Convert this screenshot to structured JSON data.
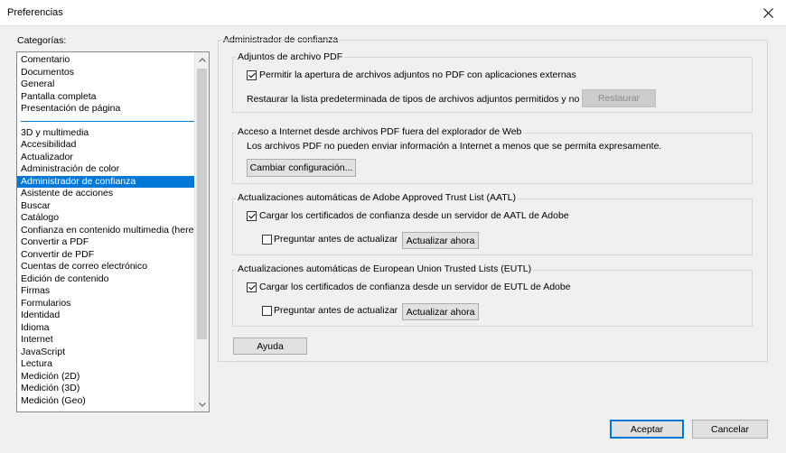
{
  "window": {
    "title": "Preferencias"
  },
  "categories": {
    "label": "Categorías:",
    "top_items": [
      "Comentario",
      "Documentos",
      "General",
      "Pantalla completa",
      "Presentación de página"
    ],
    "items": [
      "3D y multimedia",
      "Accesibilidad",
      "Actualizador",
      "Administración de color",
      "Administrador de confianza",
      "Asistente de acciones",
      "Buscar",
      "Catálogo",
      "Confianza en contenido multimedia (heredado)",
      "Convertir a PDF",
      "Convertir de PDF",
      "Cuentas de correo electrónico",
      "Edición de contenido",
      "Firmas",
      "Formularios",
      "Identidad",
      "Idioma",
      "Internet",
      "JavaScript",
      "Lectura",
      "Medición (2D)",
      "Medición (3D)",
      "Medición (Geo)"
    ],
    "selected": "Administrador de confianza"
  },
  "panel": {
    "title": "Administrador de confianza",
    "attachments": {
      "legend": "Adjuntos de archivo PDF",
      "checkbox_label": "Permitir la apertura de archivos adjuntos no PDF con aplicaciones externas",
      "checked": true,
      "restore_text": "Restaurar la lista predeterminada de tipos de archivos adjuntos permitidos y no permitidos:",
      "restore_button": "Restaurar"
    },
    "internet": {
      "legend": "Acceso a Internet desde archivos PDF fuera del explorador de Web",
      "text": "Los archivos PDF no pueden enviar información a Internet a menos que se permita expresamente.",
      "button": "Cambiar configuración..."
    },
    "aatl": {
      "legend": "Actualizaciones automáticas de Adobe Approved Trust List (AATL)",
      "checkbox_label": "Cargar los certificados de confianza desde un servidor de AATL de Adobe",
      "checked": true,
      "ask_label": "Preguntar antes de actualizar",
      "ask_checked": false,
      "update_button": "Actualizar ahora"
    },
    "eutl": {
      "legend": "Actualizaciones automáticas de European Union Trusted Lists (EUTL)",
      "checkbox_label": "Cargar los certificados de confianza desde un servidor de EUTL de Adobe",
      "checked": true,
      "ask_label": "Preguntar antes de actualizar",
      "ask_checked": false,
      "update_button": "Actualizar ahora"
    },
    "help_button": "Ayuda"
  },
  "footer": {
    "ok": "Aceptar",
    "cancel": "Cancelar"
  }
}
